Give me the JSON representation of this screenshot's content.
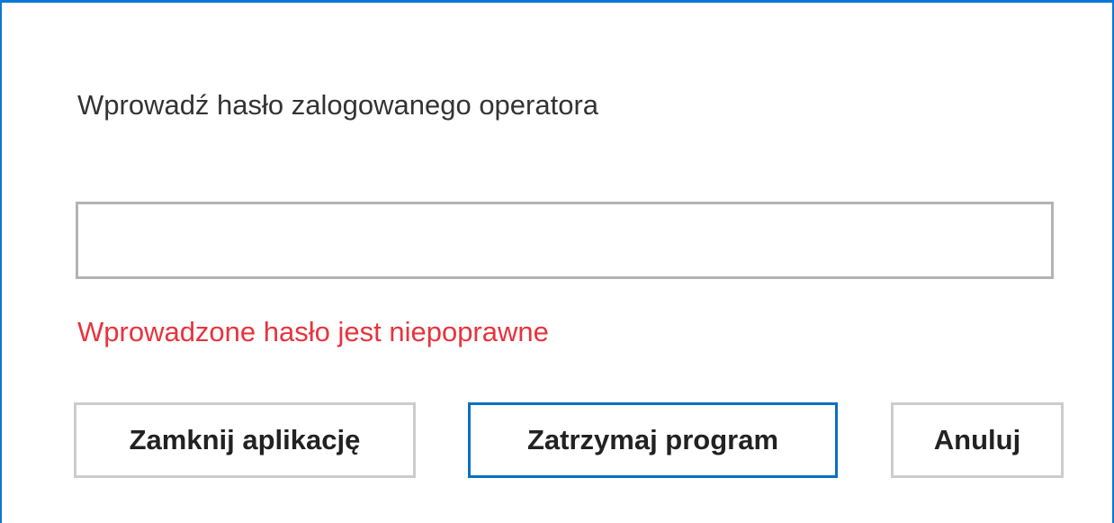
{
  "dialog": {
    "prompt": "Wprowadź hasło zalogowanego operatora",
    "password": {
      "value": "",
      "placeholder": ""
    },
    "error": "Wprowadzone hasło jest niepoprawne",
    "buttons": {
      "close_app": "Zamknij aplikację",
      "stop_program": "Zatrzymaj program",
      "cancel": "Anuluj"
    }
  },
  "colors": {
    "accent": "#0a78d4",
    "error": "#e8333d",
    "field_border": "#b3b3b3",
    "button_border": "#cccccc"
  }
}
